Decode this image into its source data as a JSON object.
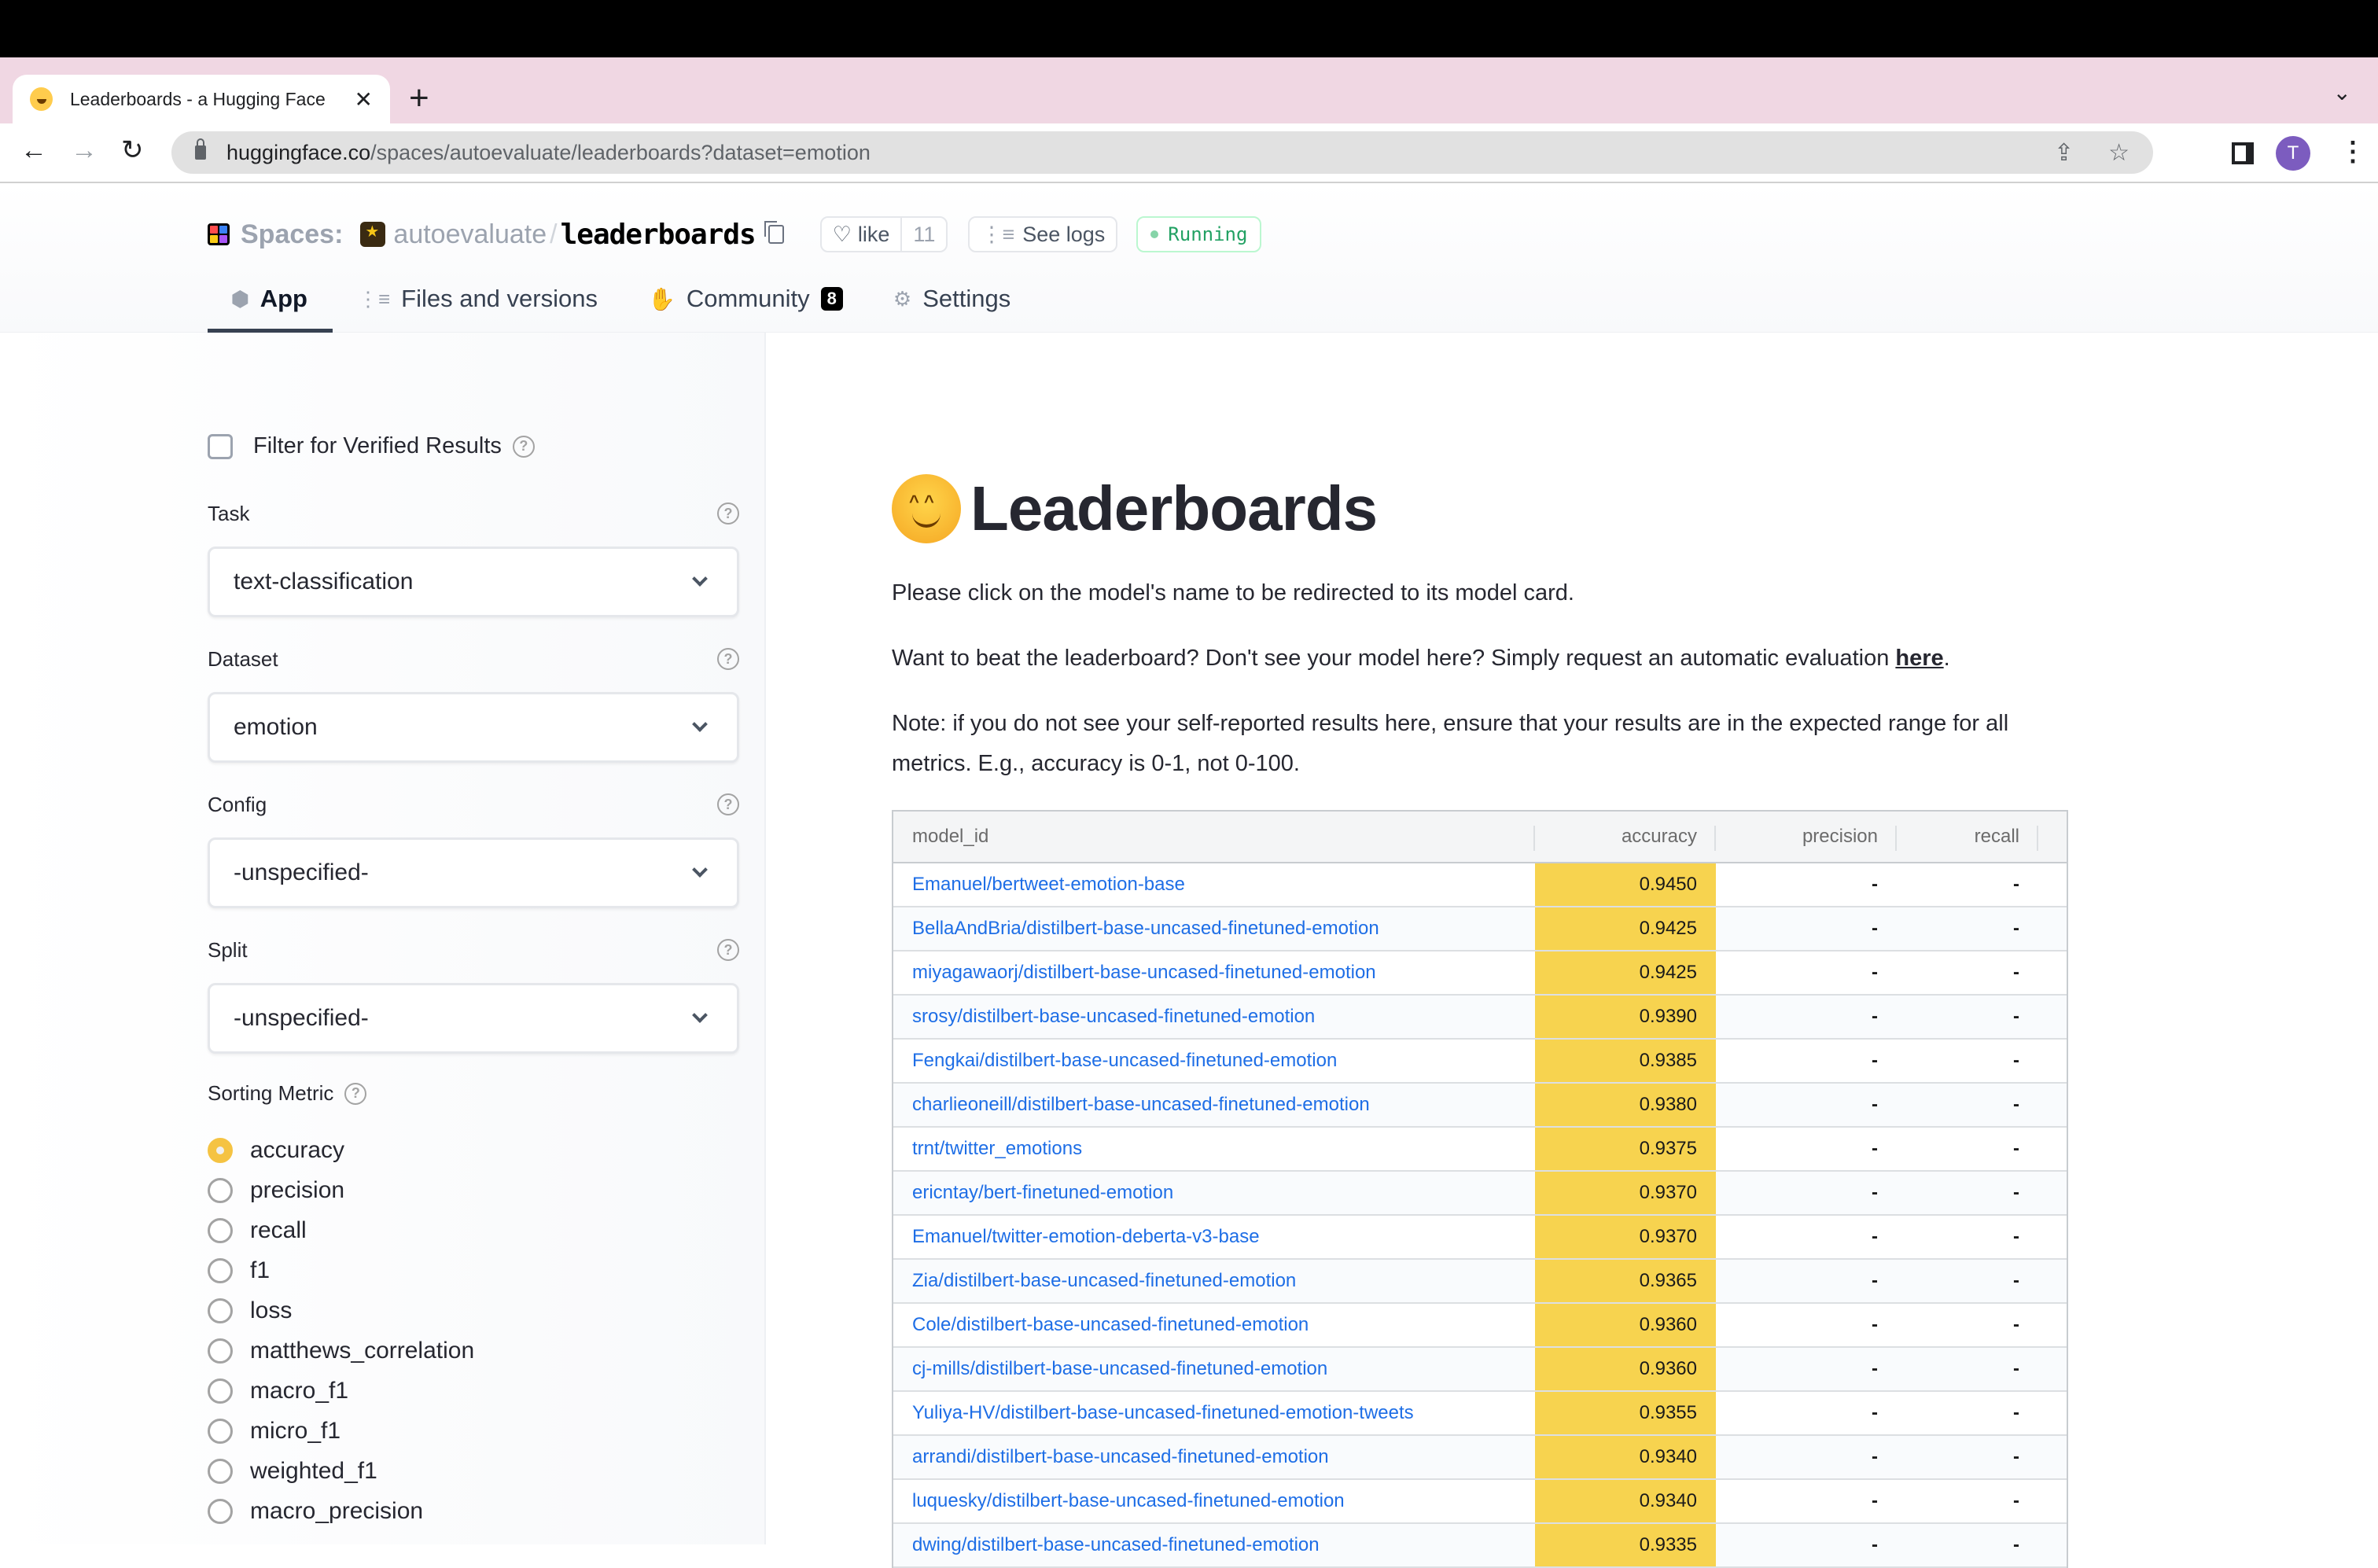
{
  "browser": {
    "tab_title": "Leaderboards - a Hugging Face",
    "tab_close": "✕",
    "new_tab": "+",
    "tab_menu": "⌄",
    "url_host": "huggingface.co",
    "url_path": "/spaces/autoevaluate/leaderboards?dataset=emotion",
    "back": "←",
    "forward": "→",
    "reload": "↻",
    "share": "⇪",
    "bookmark": "☆",
    "profile_initial": "T",
    "menu": "⋮"
  },
  "header": {
    "spaces_label": "Spaces:",
    "org": "autoevaluate",
    "slash": "/",
    "repo": "leaderboards",
    "like_label": "like",
    "like_count": "11",
    "logs_label": "See logs",
    "status": "Running",
    "tabs": [
      {
        "label": "App",
        "icon": "⬢"
      },
      {
        "label": "Files and versions",
        "icon": "⋮≡"
      },
      {
        "label": "Community",
        "icon": "✋",
        "badge": "8"
      },
      {
        "label": "Settings",
        "icon": "⚙"
      }
    ]
  },
  "sidebar": {
    "verified_filter_label": "Filter for Verified Results",
    "verified_filter_checked": false,
    "help": "?",
    "fields": [
      {
        "label": "Task",
        "value": "text-classification"
      },
      {
        "label": "Dataset",
        "value": "emotion"
      },
      {
        "label": "Config",
        "value": "-unspecified-"
      },
      {
        "label": "Split",
        "value": "-unspecified-"
      }
    ],
    "sorting_metric_label": "Sorting Metric",
    "sorting_metrics": [
      "accuracy",
      "precision",
      "recall",
      "f1",
      "loss",
      "matthews_correlation",
      "macro_f1",
      "micro_f1",
      "weighted_f1",
      "macro_precision"
    ],
    "selected_metric": "accuracy"
  },
  "main": {
    "title": "Leaderboards",
    "para1": "Please click on the model's name to be redirected to its model card.",
    "para2_before": "Want to beat the leaderboard? Don't see your model here? Simply request an automatic evaluation ",
    "para2_link": "here",
    "para2_after": ".",
    "para3": "Note: if you do not see your self-reported results here, ensure that your results are in the expected range for all metrics. E.g., accuracy is 0-1, not 0-100.",
    "table": {
      "columns": [
        "model_id",
        "accuracy",
        "precision",
        "recall"
      ],
      "rows": [
        [
          "Emanuel/bertweet-emotion-base",
          "0.9450",
          "-",
          "-"
        ],
        [
          "BellaAndBria/distilbert-base-uncased-finetuned-emotion",
          "0.9425",
          "-",
          "-"
        ],
        [
          "miyagawaorj/distilbert-base-uncased-finetuned-emotion",
          "0.9425",
          "-",
          "-"
        ],
        [
          "srosy/distilbert-base-uncased-finetuned-emotion",
          "0.9390",
          "-",
          "-"
        ],
        [
          "Fengkai/distilbert-base-uncased-finetuned-emotion",
          "0.9385",
          "-",
          "-"
        ],
        [
          "charlieoneill/distilbert-base-uncased-finetuned-emotion",
          "0.9380",
          "-",
          "-"
        ],
        [
          "trnt/twitter_emotions",
          "0.9375",
          "-",
          "-"
        ],
        [
          "ericntay/bert-finetuned-emotion",
          "0.9370",
          "-",
          "-"
        ],
        [
          "Emanuel/twitter-emotion-deberta-v3-base",
          "0.9370",
          "-",
          "-"
        ],
        [
          "Zia/distilbert-base-uncased-finetuned-emotion",
          "0.9365",
          "-",
          "-"
        ],
        [
          "Cole/distilbert-base-uncased-finetuned-emotion",
          "0.9360",
          "-",
          "-"
        ],
        [
          "cj-mills/distilbert-base-uncased-finetuned-emotion",
          "0.9360",
          "-",
          "-"
        ],
        [
          "Yuliya-HV/distilbert-base-uncased-finetuned-emotion-tweets",
          "0.9355",
          "-",
          "-"
        ],
        [
          "arrandi/distilbert-base-uncased-finetuned-emotion",
          "0.9340",
          "-",
          "-"
        ],
        [
          "luquesky/distilbert-base-uncased-finetuned-emotion",
          "0.9340",
          "-",
          "-"
        ],
        [
          "dwing/distilbert-base-uncased-finetuned-emotion",
          "0.9335",
          "-",
          "-"
        ]
      ]
    },
    "highlight_color": "#f7d34f",
    "link_color": "#1e6ee6"
  }
}
